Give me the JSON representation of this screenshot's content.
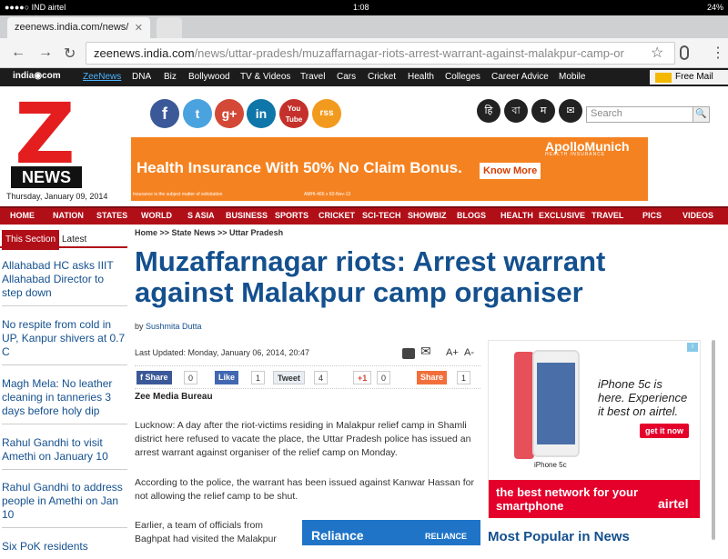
{
  "status": {
    "carrier": "●●●●○ IND airtel",
    "time": "1:08",
    "battery": "24%"
  },
  "browser": {
    "tab_title": "zeenews.india.com/news/",
    "url_host": "zeenews.india.com",
    "url_path": "/news/uttar-pradesh/muzaffarnagar-riots-arrest-warrant-against-malakpur-camp-or",
    "back": "←",
    "forward": "→",
    "reload": "↻",
    "close": "✕"
  },
  "topnav": {
    "logo": "india◉com",
    "items": [
      "ZeeNews",
      "DNA",
      "Biz",
      "Bollywood",
      "TV & Videos",
      "Travel",
      "Cars",
      "Cricket",
      "Health",
      "Colleges",
      "Career Advice",
      "Mobile"
    ],
    "mail": "Free Mail"
  },
  "logo": {
    "letter": "Z",
    "word": "NEWS"
  },
  "date": "Thursday, January 09, 2014",
  "social": {
    "items": [
      "f",
      "t",
      "g+",
      "in",
      "You Tube",
      "rss"
    ]
  },
  "languages": [
    "हि",
    "বা",
    "म",
    "✉"
  ],
  "search": {
    "placeholder": "Search",
    "button": "🔍"
  },
  "banner": {
    "headline": "Health Insurance With 50% No Claim Bonus.",
    "cta": "Know More",
    "brand": "ApolloMunich",
    "brand_sub": "HEALTH INSURANCE",
    "fine": "Insurance is the subject matter of solicitation",
    "fine2": "AMHI-466 x 60-Nov-13"
  },
  "mainnav": {
    "items": [
      "HOME",
      "NATION",
      "STATES",
      "WORLD",
      "S ASIA",
      "BUSINESS",
      "SPORTS",
      "CRICKET",
      "SCI-TECH",
      "SHOWBIZ",
      "BLOGS",
      "HEALTH",
      "EXCLUSIVE",
      "TRAVEL",
      "PICS",
      "VIDEOS"
    ]
  },
  "left": {
    "tab_active": "This Section",
    "tab_inactive": "Latest",
    "items": [
      "Allahabad HC asks IIIT Allahabad Director to step down",
      "No respite from cold in UP, Kanpur shivers at 0.7 C",
      "Magh Mela: No leather cleaning in tanneries 3 days before holy dip",
      "Rahul Gandhi to visit Amethi on January 10",
      "Rahul Gandhi to address people in Amethi on Jan 10",
      "Six PoK residents"
    ]
  },
  "article": {
    "breadcrumb": "Home >> State News >> Uttar Pradesh",
    "headline": "Muzaffarnagar riots: Arrest warrant against Malakpur camp organiser",
    "by": "by",
    "author": "Sushmita Dutta",
    "updated": "Last Updated: Monday, January 06, 2014, 20:47",
    "tools": {
      "mail": "✉",
      "font_up": "A+",
      "font_down": "A-"
    },
    "share": {
      "fb": "f Share",
      "fb_count": "0",
      "like": "Like",
      "like_count": "1",
      "tweet": "Tweet",
      "tweet_count": "4",
      "gplus": "+1",
      "gplus_count": "0",
      "share": "Share",
      "share_count": "1"
    },
    "bureau": "Zee Media Bureau",
    "paragraphs": [
      "Lucknow: A day after the riot-victims residing in Malakpur relief camp in Shamli district here refused to vacate the place, the Uttar Pradesh police has issued an arrest warrant against organiser of the relief camp on Monday.",
      "According to the police, the warrant has been issued against Kanwar Hassan for not allowing the relief camp to be shut.",
      "Earlier, a team of officials from Baghpat had visited the Malakpur"
    ]
  },
  "reliance_ad": {
    "text": "Reliance",
    "brand": "RELIANCE"
  },
  "ad": {
    "copy": "iPhone 5c is here. Experience it best on airtel.",
    "cta": "get it now",
    "model": "iPhone 5c",
    "bottom": "the best network for your smartphone",
    "brand": "airtel",
    "tag": "i"
  },
  "popular": "Most Popular in News"
}
